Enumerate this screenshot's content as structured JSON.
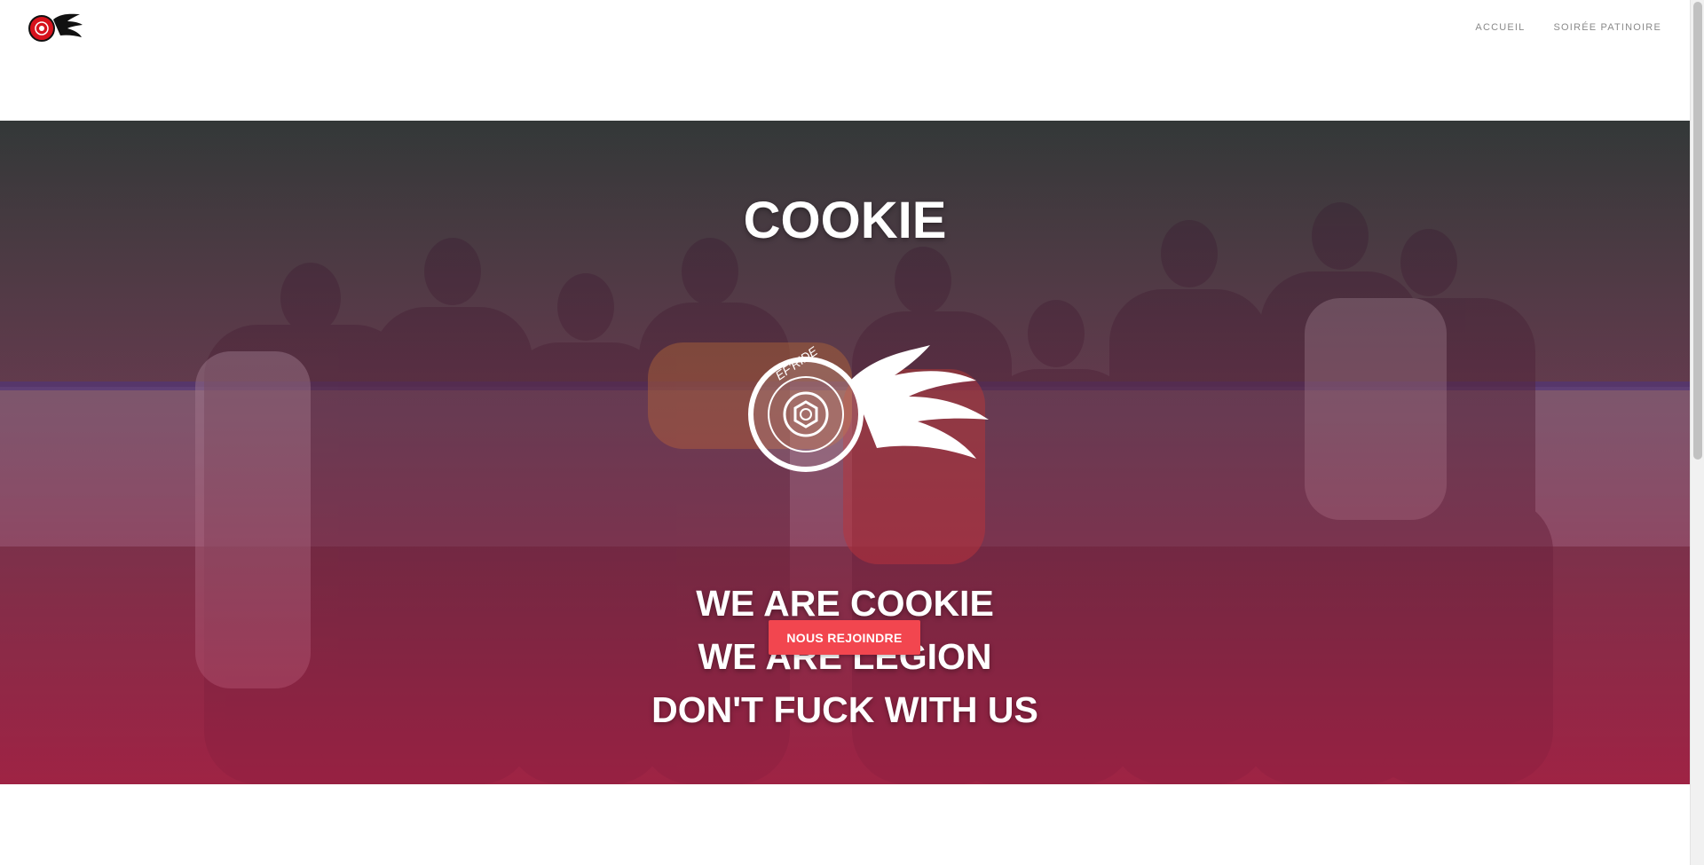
{
  "header": {
    "logo_icon": "flaming-wheel-logo-icon",
    "nav": [
      {
        "label": "ACCUEIL"
      },
      {
        "label": "SOIRÉE PATINOIRE"
      }
    ]
  },
  "hero": {
    "title": "COOKIE",
    "emblem_icon": "flaming-wheel-emblem-icon",
    "emblem_text": "EF'RIDE",
    "lines": [
      "WE ARE COOKIE",
      "WE ARE LEGION",
      "DON'T FUCK WITH US"
    ],
    "cta_label": "NOUS REJOINDRE"
  },
  "colors": {
    "accent": "#f2464f",
    "overlay": "#b91e46",
    "nav_text": "#8a8a8a",
    "logo_red": "#d7121c"
  }
}
